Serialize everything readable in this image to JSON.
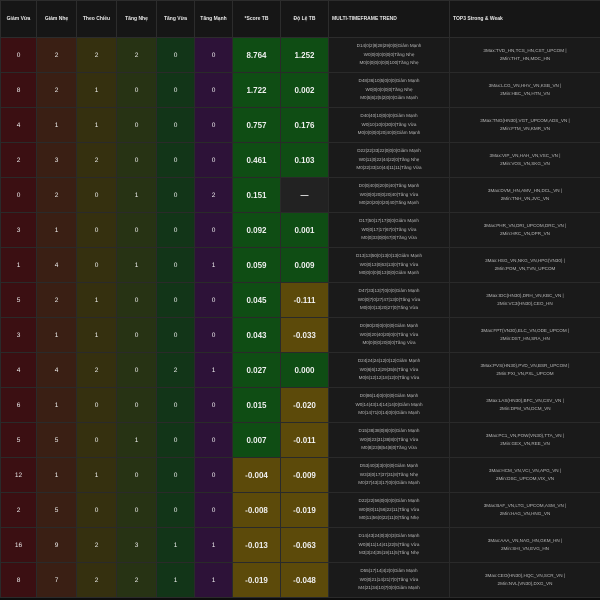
{
  "columns": [
    "Giảm Vừa",
    "Giảm Nhẹ",
    "Theo Chiều",
    "Tăng Nhẹ",
    "Tăng Vừa",
    "Tăng Mạnh",
    "*Score TB",
    "Độ Lệ TB",
    "MULTI-TIMEFRAME TREND",
    "TOP3 Strong & Weak"
  ],
  "rows": [
    {
      "gv": "0",
      "gn": "2",
      "tc": "2",
      "tn": "2",
      "tv": "0",
      "tm": "0",
      "score": "8.764",
      "dolech": "1.252",
      "sign": "pos",
      "trend": [
        "D14|0|2|9|28|29|0|0|Giảm Mạnh",
        "W0|0|0|0|0|0|0|Tăng Nhẹ",
        "M0|0|0|0|0|0|0|100|Tăng Nhẹ"
      ],
      "top": [
        "3Max:TVD_HN,TCS_HN,CST_UPCOM |",
        "2Min:THT_HN,MDC_HN"
      ]
    },
    {
      "gv": "8",
      "gn": "2",
      "tc": "1",
      "tn": "0",
      "tv": "0",
      "tm": "0",
      "score": "1.722",
      "dolech": "0.002",
      "sign": "pos",
      "trend": [
        "D48|36|10|5|0|0|0|Giảm Mạnh",
        "W0|0|0|0|0|0|Tăng Nhẹ",
        "M0|5|6|2|5|2|0|0|Giảm Mạnh"
      ],
      "top": [
        "3Max:LCG_VN,HHV_VN,KSB_VN |",
        "2Min:HBC_VN,HTN_VN"
      ]
    },
    {
      "gv": "4",
      "gn": "1",
      "tc": "1",
      "tn": "0",
      "tv": "0",
      "tm": "0",
      "score": "0.757",
      "dolech": "0.176",
      "sign": "pos",
      "trend": [
        "D40|40|10|0|0|0|Giảm Mạnh",
        "W0|10|10|0|30|0|Tăng Vừa",
        "M0|0|0|0|0|20|40|0|Giảm Mạnh"
      ],
      "top": [
        "3Max:TNG(HN30),VGT_UPCOM,ADS_VN |",
        "2Min:FTM_VN,KMR_VN"
      ]
    },
    {
      "gv": "2",
      "gn": "3",
      "tc": "2",
      "tn": "0",
      "tv": "0",
      "tm": "0",
      "score": "0.461",
      "dolech": "0.103",
      "sign": "pos",
      "trend": [
        "D22|22|33|22|0|0|0|Giảm Mạnh",
        "W0|11|0|22|44|22|0|Tăng Nhẹ",
        "M0|22|33|10|44|11|11|Tăng Vừa"
      ],
      "top": [
        "3Max:VIP_VN,HAH_VN,VSC_VN |",
        "2Min:VOS_VN,SKG_VN"
      ]
    },
    {
      "gv": "0",
      "gn": "2",
      "tc": "0",
      "tn": "1",
      "tv": "0",
      "tm": "2",
      "score": "0.151",
      "dolech": "—",
      "sign": "pos",
      "trend": [
        "D0|0|40|0|20|0|40|Tăng Mạnh",
        "W0|0|0|20|0|20|40|Tăng Vừa",
        "M0|20|20|0|20|40|Tăng Mạnh"
      ],
      "top": [
        "3Max:DVM_HN,AMV_HN,DCL_VN |",
        "2Min:TNH_VN,JVC_VN"
      ]
    },
    {
      "gv": "3",
      "gn": "1",
      "tc": "0",
      "tn": "0",
      "tv": "0",
      "tm": "0",
      "score": "0.092",
      "dolech": "0.001",
      "sign": "pos",
      "trend": [
        "D17|50|17|17|0|0|Giảm Mạnh",
        "W0|0|17|17|67|0|Tăng Vừa",
        "M0|0|33|0|0|67|0|Tăng Vừa"
      ],
      "top": [
        "3Max:PHR_VN,DRI_UPCOM,DRC_VN |",
        "2Min:HRC_VN,DPR_VN"
      ]
    },
    {
      "gv": "1",
      "gn": "4",
      "tc": "0",
      "tn": "1",
      "tv": "0",
      "tm": "1",
      "score": "0.059",
      "dolech": "0.009",
      "sign": "pos",
      "trend": [
        "D13|13|50|0|13|0|13|Giảm Mạnh",
        "W0|0|13|0|63|13|0|Tăng Vừa",
        "M0|0|0|0|0|13|0|0|Giảm Mạnh"
      ],
      "top": [
        "3Max:HSG_VN,NKG_VN,HPG(VN30) |",
        "2Min:POM_VN,TVN_UPCOM"
      ]
    },
    {
      "gv": "5",
      "gn": "2",
      "tc": "1",
      "tn": "0",
      "tv": "0",
      "tm": "0",
      "score": "0.045",
      "dolech": "-0.111",
      "sign": "mix",
      "trend": [
        "D47|33|13|7|0|0|0|Giảm Mạnh",
        "W0|0|7|0|27|47|13|0|Tăng Vừa",
        "M0|0|0|13|20|27|0|Tăng Vừa"
      ],
      "top": [
        "3Max:IDC(HN30),DRH_VN,KBC_VN |",
        "2Min:VC3(HN30),CEO_HN"
      ]
    },
    {
      "gv": "3",
      "gn": "1",
      "tc": "1",
      "tn": "0",
      "tv": "0",
      "tm": "0",
      "score": "0.043",
      "dolech": "-0.033",
      "sign": "mix",
      "trend": [
        "D0|80|20|0|0|0|0|Giảm Mạnh",
        "W0|0|20|40|20|0|0|Tăng Vừa",
        "M0|0|0|0|20|0|0|Tăng Vừa"
      ],
      "top": [
        "3Max:FPT(VN30),ELC_VN,ODE_UPCOM |",
        "2Min:DST_HN,SRA_HN"
      ]
    },
    {
      "gv": "4",
      "gn": "4",
      "tc": "2",
      "tn": "0",
      "tv": "2",
      "tm": "1",
      "score": "0.027",
      "dolech": "0.000",
      "sign": "pos",
      "trend": [
        "D24|24|24|12|0|12|Giảm Mạnh",
        "W0|6|6|12|29|35|6|Tăng Vừa",
        "M0|6|12|12|18|12|0|Tăng Vừa"
      ],
      "top": [
        "3Max:PVS(HN30),PVD_VN,BSR_UPCOM |",
        "2Min:PXI_VN,PXL_UPCOM"
      ]
    },
    {
      "gv": "6",
      "gn": "1",
      "tc": "0",
      "tn": "0",
      "tv": "0",
      "tm": "0",
      "score": "0.015",
      "dolech": "-0.020",
      "sign": "mix",
      "trend": [
        "D0|86|14|0|0|0|0|Giảm Mạnh",
        "W0|14|43|14|14|14|0|Giảm Mạnh",
        "M0|14|71|0|14|0|0|Giảm Mạnh"
      ],
      "top": [
        "3Max:LAS(HN30),BFC_VN,CSV_VN |",
        "2Min:DPM_VN,DCM_VN"
      ]
    },
    {
      "gv": "5",
      "gn": "5",
      "tc": "0",
      "tn": "1",
      "tv": "0",
      "tm": "0",
      "score": "0.007",
      "dolech": "-0.011",
      "sign": "mix",
      "trend": [
        "D15|38|38|0|8|0|0|Giảm Mạnh",
        "W0|0|23|31|38|8|0|Tăng Vừa",
        "M0|8|23|8|54|8|0|Tăng Vừa"
      ],
      "top": [
        "3Max:PC1_VN,POW(VN30),TTA_VN |",
        "2Min:GEX_VN,REE_VN"
      ]
    },
    {
      "gv": "12",
      "gn": "1",
      "tc": "1",
      "tn": "0",
      "tv": "0",
      "tm": "0",
      "score": "-0.004",
      "dolech": "-0.009",
      "sign": "neg",
      "trend": [
        "D53|40|3|3|0|0|0|Giảm Mạnh",
        "W3|3|0|17|37|31|8|Tăng Nhẹ",
        "M0|37|43|3|17|0|0|Giảm Mạnh"
      ],
      "top": [
        "3Max:HCM_VN,VCI_VN,APG_VN |",
        "2Min:DSC_UPCOM,VIX_VN"
      ]
    },
    {
      "gv": "2",
      "gn": "5",
      "tc": "0",
      "tn": "0",
      "tv": "0",
      "tm": "0",
      "score": "-0.008",
      "dolech": "-0.019",
      "sign": "neg",
      "trend": [
        "D22|22|56|0|0|0|0|Giảm Mạnh",
        "W0|0|0|11|56|22|11|Tăng Vừa",
        "M0|11|56|0|22|11|0|Tăng Nhẹ"
      ],
      "top": [
        "3Max:BAF_VN,LTG_UPCOM,ASM_VN |",
        "2Min:HAG_VN,HNG_VN"
      ]
    },
    {
      "gv": "16",
      "gn": "9",
      "tc": "2",
      "tn": "3",
      "tv": "1",
      "tm": "1",
      "score": "-0.013",
      "dolech": "-0.063",
      "sign": "neg",
      "trend": [
        "D14|43|24|0|3|0|3|Giảm Mạnh",
        "W0|8|11|14|41|22|5|Tăng Vừa",
        "M3|3|24|35|19|11|5|Tăng Nhẹ"
      ],
      "top": [
        "3Max:AAA_VN,NAG_HN,GKM_HN |",
        "2Min:SHI_VN,EVG_HN"
      ]
    },
    {
      "gv": "8",
      "gn": "7",
      "tc": "2",
      "tn": "2",
      "tv": "1",
      "tm": "1",
      "score": "-0.019",
      "dolech": "-0.048",
      "sign": "neg",
      "trend": [
        "D55|17|14|4|2|0|Giảm Mạnh",
        "W0|0|21|14|21|7|0|Tăng Vừa",
        "M4|21|34|10|7|0|0|Giảm Mạnh"
      ],
      "top": [
        "3Max:CEO(HN30),HQC_VN,SCR_VN |",
        "2Min:NVL(VN30),DXG_VN"
      ]
    }
  ]
}
